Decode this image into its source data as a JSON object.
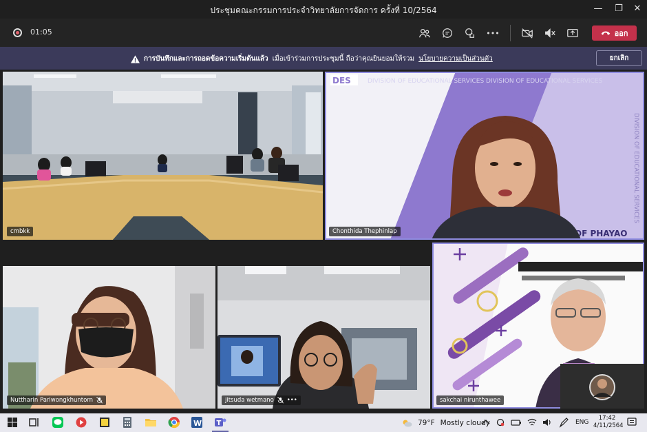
{
  "window": {
    "title": "ประชุมคณะกรรมการประจำวิทยาลัยการจัดการ ครั้งที่ 10/2564",
    "minimize_glyph": "—",
    "maximize_glyph": "❐",
    "close_glyph": "✕"
  },
  "toolbar": {
    "recording_timer": "01:05",
    "leave_label": "ออก",
    "icons": [
      "people-icon",
      "chat-icon",
      "reactions-icon",
      "more-icon",
      "camera-off-icon",
      "mic-muted-icon",
      "share-icon"
    ],
    "more_glyph": "•••"
  },
  "banner": {
    "bold_text": "การบันทึกและการถอดข้อความเริ่มต้นแล้ว",
    "text": "เมื่อเข้าร่วมการประชุมนี้ ถือว่าคุณยินยอมให้รวม",
    "link_text": "นโยบายความเป็นส่วนตัว",
    "dismiss_label": "ยกเลิก"
  },
  "participants": [
    {
      "name": "cmbkk"
    },
    {
      "name": "Chonthida Thephinlap",
      "bg_text": "DIVISION OF EDUCATIONAL SERVICES  DIVISION OF EDUCATIONAL SERVICES",
      "side_text": "DIVISION OF EDUCATIONAL SERVICES",
      "bottom_text": "Y OF PHAYAO",
      "logo_text": "DES"
    },
    {
      "name": "Nuttharin Pariwongkhuntorn"
    },
    {
      "name": "jitsuda wetmano"
    },
    {
      "name": "sakchai nirunthawee"
    }
  ],
  "taskbar": {
    "weather_temp": "79°F",
    "weather_text": "Mostly cloudy",
    "language": "ENG",
    "time": "17:42",
    "date": "4/11/2564"
  },
  "colors": {
    "leave_red": "#c4314b",
    "banner_bg": "#3b3a5a",
    "pin_border": "#8f8ce0"
  }
}
